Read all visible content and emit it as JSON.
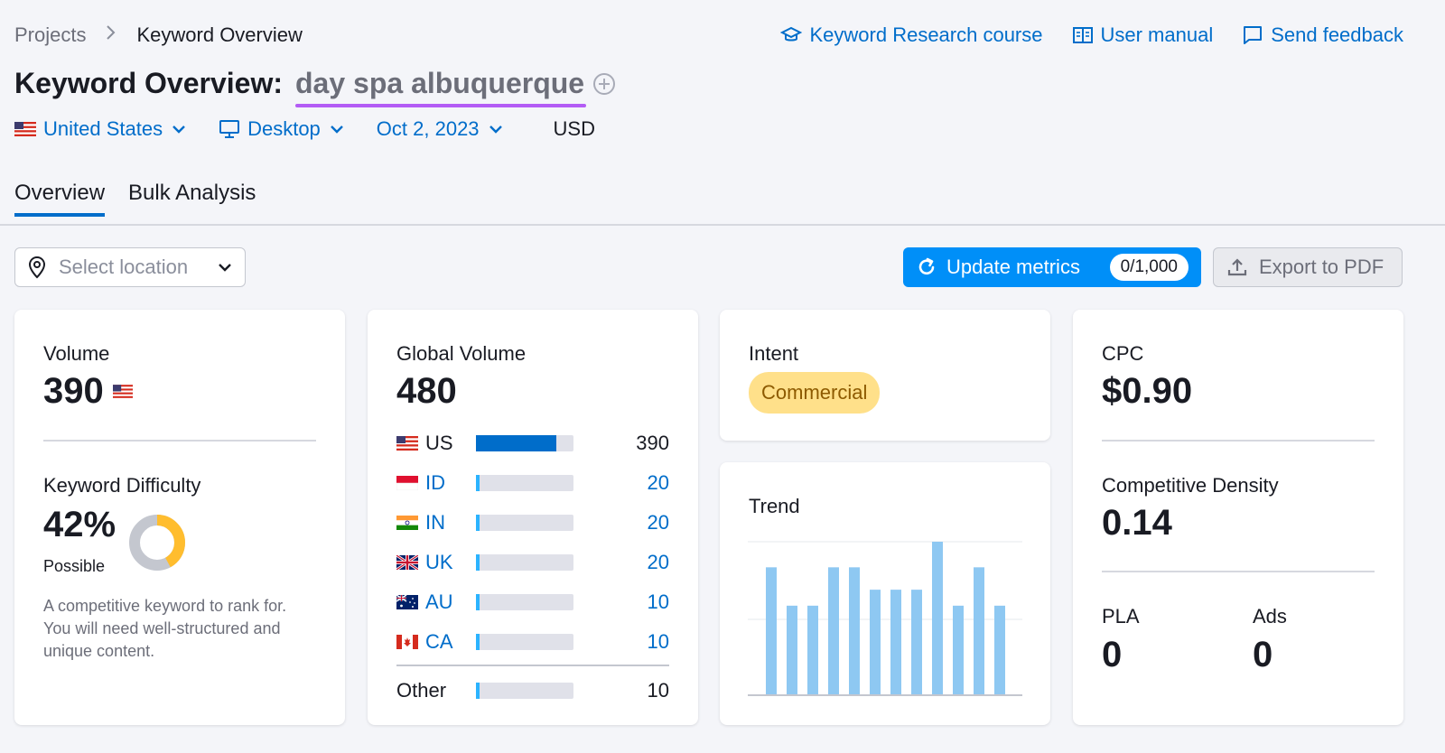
{
  "breadcrumb": {
    "root": "Projects",
    "current": "Keyword Overview"
  },
  "top_links": [
    {
      "label": "Keyword Research course",
      "icon": "graduation-cap-icon"
    },
    {
      "label": "User manual",
      "icon": "book-icon"
    },
    {
      "label": "Send feedback",
      "icon": "chat-icon"
    }
  ],
  "title": {
    "prefix": "Keyword Overview:",
    "keyword": "day spa albuquerque"
  },
  "filters": {
    "country": "United States",
    "device": "Desktop",
    "date": "Oct 2, 2023",
    "currency": "USD"
  },
  "tabs": [
    {
      "label": "Overview",
      "active": true
    },
    {
      "label": "Bulk Analysis",
      "active": false
    }
  ],
  "location": {
    "placeholder": "Select location"
  },
  "update": {
    "label": "Update metrics",
    "count": "0/1,000"
  },
  "export": {
    "label": "Export to PDF"
  },
  "volume": {
    "label": "Volume",
    "value": "390",
    "difficulty_label": "Keyword Difficulty",
    "difficulty_value": "42%",
    "difficulty_level": "Possible",
    "difficulty_percent": 42,
    "description": "A competitive keyword to rank for. You will need well-structured and unique content."
  },
  "global": {
    "label": "Global Volume",
    "value": "480",
    "countries": [
      {
        "code": "US",
        "value": "390",
        "share": 0.82,
        "link": false
      },
      {
        "code": "ID",
        "value": "20",
        "share": 0.04,
        "link": true
      },
      {
        "code": "IN",
        "value": "20",
        "share": 0.04,
        "link": true
      },
      {
        "code": "UK",
        "value": "20",
        "share": 0.04,
        "link": true
      },
      {
        "code": "AU",
        "value": "10",
        "share": 0.02,
        "link": true
      },
      {
        "code": "CA",
        "value": "10",
        "share": 0.02,
        "link": true
      }
    ],
    "other": {
      "code": "Other",
      "value": "10",
      "share": 0.02
    }
  },
  "intent": {
    "label": "Intent",
    "value": "Commercial"
  },
  "trend": {
    "label": "Trend",
    "values": [
      2,
      1.4,
      1.4,
      2,
      2,
      1.65,
      1.65,
      1.65,
      2.4,
      1.4,
      2,
      1.4
    ],
    "max": 2.4
  },
  "cpc": {
    "label": "CPC",
    "value": "$0.90",
    "density_label": "Competitive Density",
    "density_value": "0.14",
    "pla_label": "PLA",
    "pla_value": "0",
    "ads_label": "Ads",
    "ads_value": "0"
  },
  "colors": {
    "accent": "#006dca",
    "button": "#008ff8",
    "bar_us": "#006dca",
    "bar_small": "#2bb3ff",
    "trend": "#8ec8f2",
    "kd_fill": "#ffbd2e",
    "kd_track": "#c4c7cf"
  }
}
